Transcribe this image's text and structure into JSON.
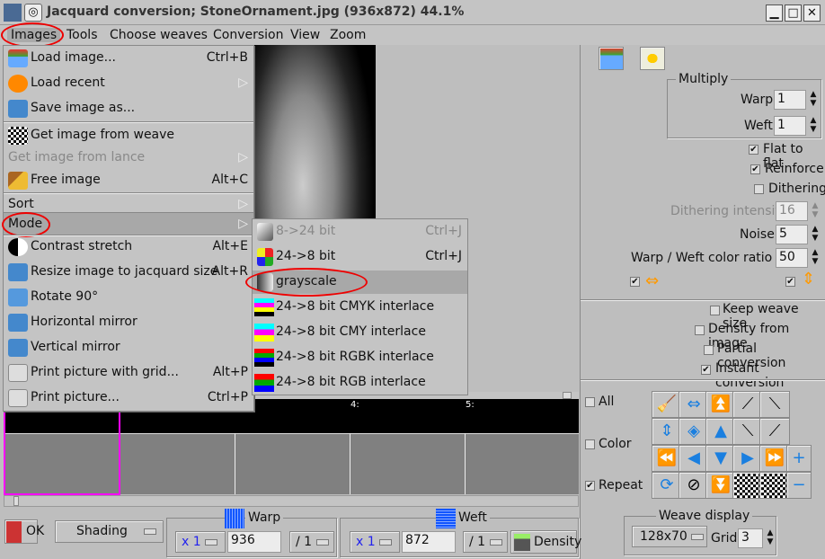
{
  "window": {
    "title": "Jacquard conversion; StoneOrnament.jpg (936x872) 44.1%",
    "minimize": "▁",
    "maximize": "□",
    "close": "✕"
  },
  "menubar": [
    {
      "label": "Images"
    },
    {
      "label": "Tools"
    },
    {
      "label": "Choose weaves"
    },
    {
      "label": "Conversion"
    },
    {
      "label": "View"
    },
    {
      "label": "Zoom"
    }
  ],
  "images_menu": [
    {
      "label": "Load image...",
      "shortcut": "Ctrl+B",
      "icon": "folder-icon"
    },
    {
      "label": "Load recent",
      "shortcut": "▷",
      "icon": "clock-icon"
    },
    {
      "label": "Save image as...",
      "shortcut": "",
      "icon": "save-icon"
    },
    {
      "label": "Get image from weave",
      "shortcut": "",
      "icon": "weave-icon"
    },
    {
      "label": "Get image from lance",
      "shortcut": "▷",
      "icon": "",
      "disabled": true
    },
    {
      "label": "Free image",
      "shortcut": "Alt+C",
      "icon": "broom-icon"
    },
    {
      "label": "Sort",
      "shortcut": "▷",
      "icon": ""
    },
    {
      "label": "Mode",
      "shortcut": "▷",
      "icon": "",
      "highlighted": true
    },
    {
      "label": "Contrast stretch",
      "shortcut": "Alt+E",
      "icon": "contrast-icon"
    },
    {
      "label": "Resize image to jacquard size",
      "shortcut": "Alt+R",
      "icon": "resize-icon"
    },
    {
      "label": "Rotate 90°",
      "shortcut": "",
      "icon": "rotate-icon"
    },
    {
      "label": "Horizontal mirror",
      "shortcut": "",
      "icon": "horizontal-mirror-icon"
    },
    {
      "label": "Vertical mirror",
      "shortcut": "",
      "icon": "vertical-mirror-icon"
    },
    {
      "label": "Print picture with grid...",
      "shortcut": "Alt+P",
      "icon": "printer-icon"
    },
    {
      "label": "Print picture...",
      "shortcut": "Ctrl+P",
      "icon": "printer-icon"
    }
  ],
  "mode_menu": [
    {
      "label": "8->24 bit",
      "shortcut": "Ctrl+J",
      "disabled": true
    },
    {
      "label": "24->8 bit",
      "shortcut": "Ctrl+J"
    },
    {
      "label": "grayscale",
      "shortcut": "",
      "highlighted": true
    },
    {
      "label": "24->8 bit CMYK interlace",
      "shortcut": ""
    },
    {
      "label": "24->8 bit CMY interlace",
      "shortcut": ""
    },
    {
      "label": "24->8 bit RGBK interlace",
      "shortcut": ""
    },
    {
      "label": "24->8 bit RGB interlace",
      "shortcut": ""
    }
  ],
  "strip": {
    "labels": [
      "4:",
      "5:"
    ]
  },
  "panel": {
    "multiply": {
      "title": "Multiply",
      "warp_label": "Warp",
      "warp": "1",
      "weft_label": "Weft",
      "weft": "1"
    },
    "flat_to_flat": {
      "label": "Flat to flat",
      "checked": true
    },
    "reinforce": {
      "label": "Reinforce",
      "checked": true
    },
    "dithering": {
      "label": "Dithering",
      "checked": false
    },
    "dithering_intensity": {
      "label": "Dithering intensity",
      "value": "16"
    },
    "noise": {
      "label": "Noise",
      "value": "5"
    },
    "ratio": {
      "label": "Warp / Weft color ratio %",
      "value": "50"
    },
    "keep_weave_size": {
      "label": "Keep weave size",
      "checked": false
    },
    "density_from_image": {
      "label": "Density from image",
      "checked": false
    },
    "partial_conversion": {
      "label": "Partial conversion",
      "checked": false
    },
    "instant_conversion": {
      "label": "Instant conversion",
      "checked": true
    },
    "all": {
      "label": "All",
      "checked": false
    },
    "color": {
      "label": "Color",
      "checked": false
    },
    "repeat": {
      "label": "Repeat",
      "checked": true
    },
    "weave_display": {
      "title": "Weave display",
      "size": "128x70",
      "grid_label": "Grid",
      "grid": "3"
    }
  },
  "bottom": {
    "ok": "OK",
    "shading": "Shading",
    "warp_title": "Warp",
    "warp_mult": "x 1",
    "warp_value": "936",
    "warp_div": "/ 1",
    "weft_title": "Weft",
    "weft_mult": "x 1",
    "weft_value": "872",
    "weft_div": "/ 1",
    "density": "Density"
  },
  "colors": {
    "highlight_ring": "#e00000",
    "selection": "#ff00ff",
    "accent": "#1a7fe0"
  }
}
